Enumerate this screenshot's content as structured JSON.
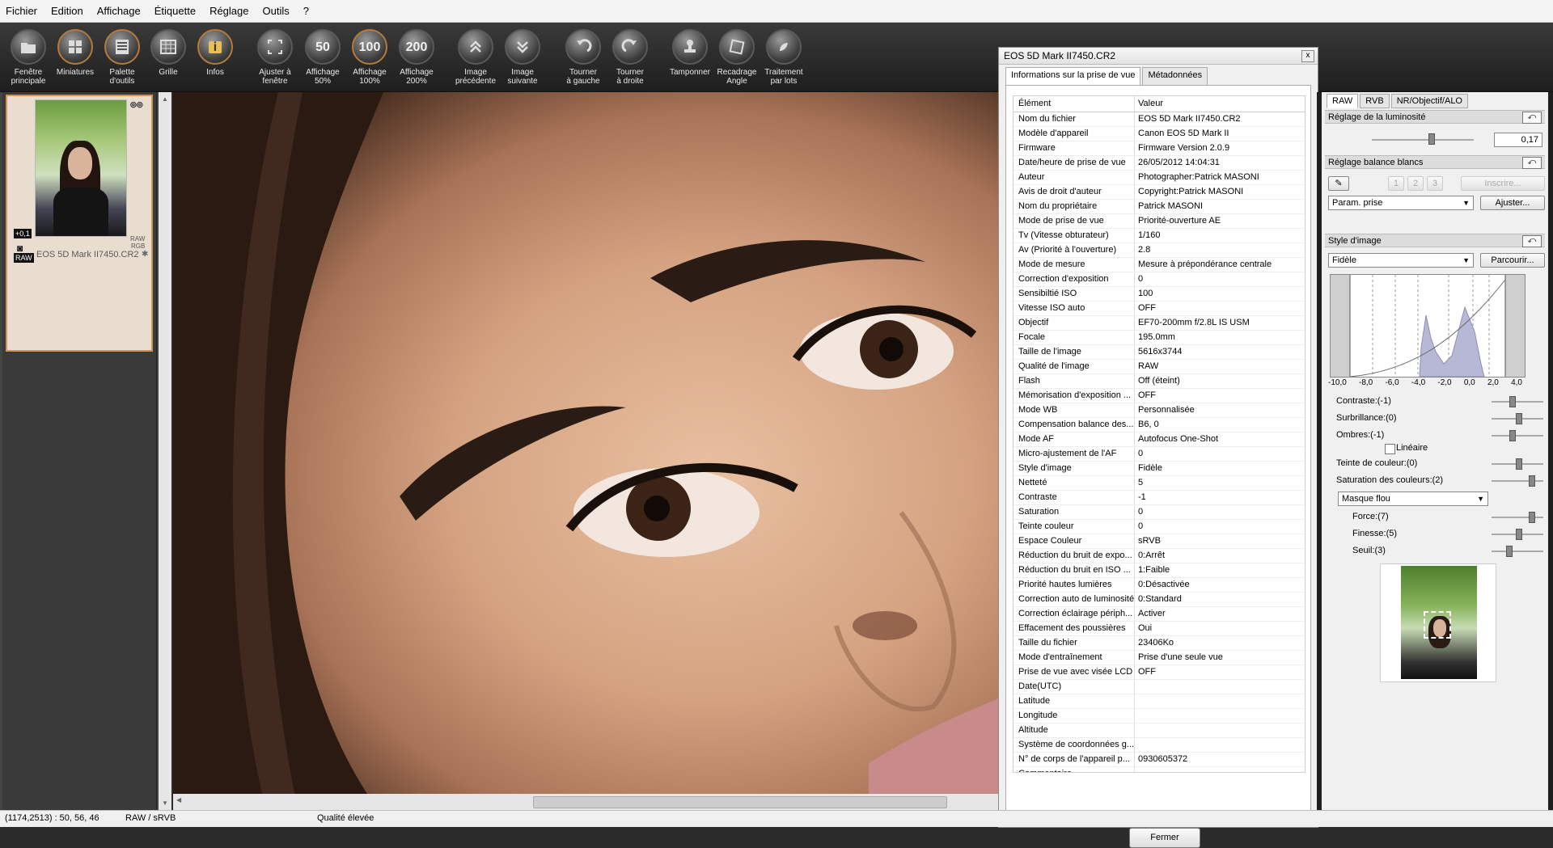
{
  "menu": [
    "Fichier",
    "Edition",
    "Affichage",
    "Étiquette",
    "Réglage",
    "Outils",
    "?"
  ],
  "toolbar": [
    {
      "l1": "Fenêtre",
      "l2": "principale",
      "icon": "folder-icon"
    },
    {
      "l1": "Miniatures",
      "l2": "",
      "icon": "thumbnails-icon"
    },
    {
      "l1": "Palette",
      "l2": "d'outils",
      "icon": "tool-palette-icon"
    },
    {
      "l1": "Grille",
      "l2": "",
      "icon": "grid-icon"
    },
    {
      "l1": "Infos",
      "l2": "",
      "icon": "info-icon"
    },
    {
      "l1": "Ajuster à",
      "l2": "fenêtre",
      "icon": "fit-window-icon"
    },
    {
      "l1": "Affichage",
      "l2": "50%",
      "icon": "zoom-50-icon"
    },
    {
      "l1": "Affichage",
      "l2": "100%",
      "icon": "zoom-100-icon"
    },
    {
      "l1": "Affichage",
      "l2": "200%",
      "icon": "zoom-200-icon"
    },
    {
      "l1": "Image",
      "l2": "précédente",
      "icon": "prev-image-icon"
    },
    {
      "l1": "Image",
      "l2": "suivante",
      "icon": "next-image-icon"
    },
    {
      "l1": "Tourner",
      "l2": "à gauche",
      "icon": "rotate-left-icon"
    },
    {
      "l1": "Tourner",
      "l2": "à droite",
      "icon": "rotate-right-icon"
    },
    {
      "l1": "Tamponner",
      "l2": "",
      "icon": "stamp-icon"
    },
    {
      "l1": "Recadrage",
      "l2": "Angle",
      "icon": "crop-icon"
    },
    {
      "l1": "Traitement",
      "l2": "par lots",
      "icon": "batch-icon"
    }
  ],
  "toolbar_glyphs": {
    "zoom50": "50",
    "zoom100": "100",
    "zoom200": "200",
    "info": "i"
  },
  "thumbnail": {
    "name": "EOS 5D Mark II7450.CR2",
    "exposure_badge": "+0,1",
    "raw_badge": "RAW",
    "format_line1": "RAW",
    "format_line2": "RGB"
  },
  "dialog": {
    "title": "EOS 5D Mark II7450.CR2",
    "close": "x",
    "tab_info": "Informations sur la prise de vue",
    "tab_meta": "Métadonnées",
    "col_key": "Élément",
    "col_val": "Valeur",
    "rows": [
      [
        "Nom du fichier",
        "EOS 5D Mark II7450.CR2"
      ],
      [
        "Modèle d'appareil",
        "Canon EOS 5D Mark II"
      ],
      [
        "Firmware",
        "Firmware Version 2.0.9"
      ],
      [
        "Date/heure de prise de vue",
        "26/05/2012 14:04:31"
      ],
      [
        "Auteur",
        "Photographer:Patrick MASONI"
      ],
      [
        "Avis de droit d'auteur",
        "Copyright:Patrick MASONI"
      ],
      [
        "Nom du propriétaire",
        "Patrick MASONI"
      ],
      [
        "Mode de prise de vue",
        "Priorité-ouverture AE"
      ],
      [
        "Tv (Vitesse obturateur)",
        "1/160"
      ],
      [
        "Av (Priorité à l'ouverture)",
        "2.8"
      ],
      [
        "Mode de mesure",
        "Mesure à prépondérance centrale"
      ],
      [
        "Correction d'exposition",
        "0"
      ],
      [
        "Sensibiltié ISO",
        "100"
      ],
      [
        "Vitesse ISO auto",
        "OFF"
      ],
      [
        "Objectif",
        "EF70-200mm f/2.8L IS USM"
      ],
      [
        "Focale",
        "195.0mm"
      ],
      [
        "Taille de l'image",
        "5616x3744"
      ],
      [
        "Qualité de l'image",
        "RAW"
      ],
      [
        "Flash",
        "Off (éteint)"
      ],
      [
        "Mémorisation d'exposition ...",
        "OFF"
      ],
      [
        "Mode WB",
        "Personnalisée"
      ],
      [
        "Compensation balance des...",
        "B6, 0"
      ],
      [
        "Mode AF",
        "Autofocus One-Shot"
      ],
      [
        "Micro-ajustement de l'AF",
        "0"
      ],
      [
        "Style d'image",
        "Fidèle"
      ],
      [
        "Netteté",
        "5"
      ],
      [
        "Contraste",
        "-1"
      ],
      [
        "Saturation",
        "0"
      ],
      [
        "Teinte couleur",
        "0"
      ],
      [
        "Espace Couleur",
        "sRVB"
      ],
      [
        "Réduction du bruit de expo...",
        "0:Arrêt"
      ],
      [
        "Réduction du bruit en ISO ...",
        "1:Faible"
      ],
      [
        "Priorité hautes lumières",
        "0:Désactivée"
      ],
      [
        "Correction auto de luminosité",
        "0:Standard"
      ],
      [
        "Correction éclairage périph...",
        "Activer"
      ],
      [
        "Effacement des poussières",
        "Oui"
      ],
      [
        "Taille du fichier",
        "23406Ko"
      ],
      [
        "Mode d'entraînement",
        "Prise d'une seule vue"
      ],
      [
        "Prise de vue avec visée LCD",
        "OFF"
      ],
      [
        "Date(UTC)",
        ""
      ],
      [
        "Latitude",
        ""
      ],
      [
        "Longitude",
        ""
      ],
      [
        "Altitude",
        ""
      ],
      [
        "Système de coordonnées g...",
        ""
      ],
      [
        "N° de corps de l'appareil p...",
        "0930605372"
      ],
      [
        "Commentaire",
        ""
      ]
    ],
    "close_button": "Fermer"
  },
  "right": {
    "tabs": [
      "RAW",
      "RVB",
      "NR/Objectif/ALO"
    ],
    "brightness_title": "Réglage de la luminosité",
    "brightness_value": "0,17",
    "wb_title": "Réglage balance blancs",
    "wb_buttons": [
      "1",
      "2",
      "3"
    ],
    "wb_register": "Inscrire...",
    "wb_select": "Param. prise",
    "wb_adjust": "Ajuster...",
    "style_title": "Style d'image",
    "style_select": "Fidèle",
    "style_browse": "Parcourir...",
    "histo_ticks": [
      "-10,0",
      "-8,0",
      "-6,0",
      "-4,0",
      "-2,0",
      "0,0",
      "2,0",
      "4,0"
    ],
    "contrast": "Contraste:(-1)",
    "highlights": "Surbrillance:(0)",
    "shadows": "Ombres:(-1)",
    "linear": "Linéaire",
    "tint": "Teinte de couleur:(0)",
    "saturation": "Saturation des couleurs:(2)",
    "unsharp_select": "Masque flou",
    "strength": "Force:(7)",
    "fineness": "Finesse:(5)",
    "threshold": "Seuil:(3)",
    "restore": "⤺"
  },
  "status": {
    "coords": "(1174,2513) :  50, 56, 46",
    "colorspace": "RAW / sRVB",
    "quality": "Qualité élevée"
  }
}
